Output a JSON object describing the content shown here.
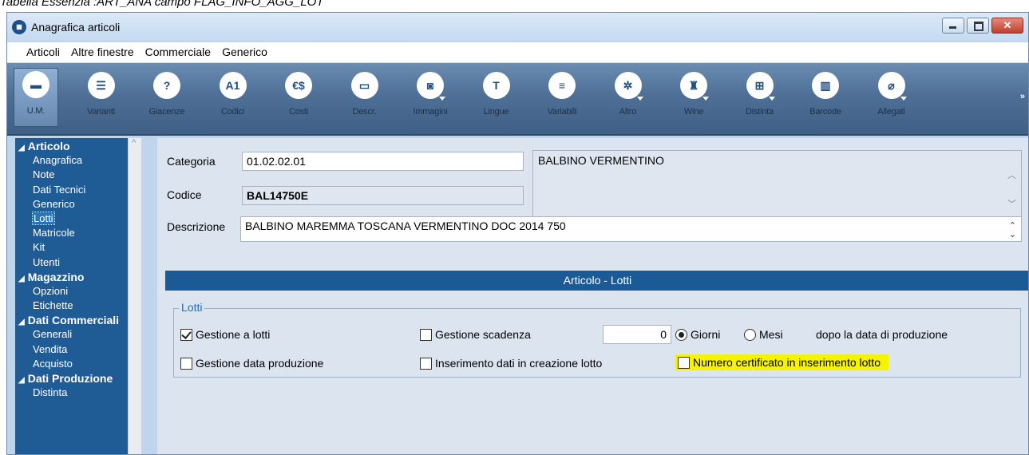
{
  "caption": "Tabella Essenzia :ART_ANA campo FLAG_INFO_AGG_LOT",
  "window": {
    "title": "Anagrafica articoli",
    "close_glyph": "✕"
  },
  "menu": [
    "Articoli",
    "Altre finestre",
    "Commerciale",
    "Generico"
  ],
  "toolbar": {
    "more_glyph": "»",
    "buttons": [
      {
        "label": "U.M.",
        "glyph": "▬",
        "icon": "ruler-icon"
      },
      {
        "label": "Varianti",
        "glyph": "☰",
        "icon": "variants-icon"
      },
      {
        "label": "Giacenze",
        "glyph": "?",
        "icon": "stock-bag-icon"
      },
      {
        "label": "Codici",
        "glyph": "A1",
        "icon": "codes-icon"
      },
      {
        "label": "Costi",
        "glyph": "€$",
        "icon": "costs-icon"
      },
      {
        "label": "Descr.",
        "glyph": "▭",
        "icon": "description-icon"
      },
      {
        "label": "Immagini",
        "glyph": "◙",
        "icon": "camera-icon"
      },
      {
        "label": "Lingue",
        "glyph": "T",
        "icon": "languages-icon"
      },
      {
        "label": "Variabili",
        "glyph": "≡",
        "icon": "variables-icon"
      },
      {
        "label": "Altro",
        "glyph": "✲",
        "icon": "other-icon"
      },
      {
        "label": "Wine",
        "glyph": "♜",
        "icon": "wine-icon"
      },
      {
        "label": "Distinta",
        "glyph": "⊞",
        "icon": "bill-of-materials-icon"
      },
      {
        "label": "Barcode",
        "glyph": "▥",
        "icon": "barcode-icon"
      },
      {
        "label": "Allegati",
        "glyph": "⌀",
        "icon": "paperclip-icon"
      }
    ]
  },
  "sidebar": {
    "groups": [
      {
        "label": "Articolo",
        "items": [
          "Anagrafica",
          "Note",
          "Dati Tecnici",
          "Generico",
          "Lotti",
          "Matricole",
          "Kit",
          "Utenti"
        ]
      },
      {
        "label": "Magazzino",
        "items": [
          "Opzioni",
          "Etichette"
        ]
      },
      {
        "label": "Dati Commerciali",
        "items": [
          "Generali",
          "Vendita",
          "Acquisto"
        ]
      },
      {
        "label": "Dati Produzione",
        "items": [
          "Distinta"
        ]
      }
    ],
    "selected": "Lotti"
  },
  "form": {
    "categoria_label": "Categoria",
    "categoria_value": "01.02.02.01",
    "categoria_desc": "BALBINO VERMENTINO",
    "codice_label": "Codice",
    "codice_value": "BAL14750E",
    "descrizione_label": "Descrizione",
    "descrizione_value": "BALBINO  MAREMMA TOSCANA VERMENTINO DOC 2014 750"
  },
  "section_title": "Articolo - Lotti",
  "lotti": {
    "legend": "Lotti",
    "gestione_lotti": {
      "label": "Gestione a lotti",
      "checked": true
    },
    "gestione_scadenza": {
      "label": "Gestione scadenza",
      "checked": false
    },
    "scadenza_value": "0",
    "radio_giorni": {
      "label": "Giorni",
      "selected": true
    },
    "radio_mesi": {
      "label": "Mesi",
      "selected": false
    },
    "dopo_text": "dopo la data di produzione",
    "gestione_data_produzione": {
      "label": "Gestione data produzione",
      "checked": false
    },
    "inserimento_dati": {
      "label": "Inserimento dati in creazione lotto",
      "checked": false
    },
    "numero_certificato": {
      "label": "Numero certificato in inserimento lotto",
      "checked": false,
      "highlight": "#f6f300"
    }
  }
}
